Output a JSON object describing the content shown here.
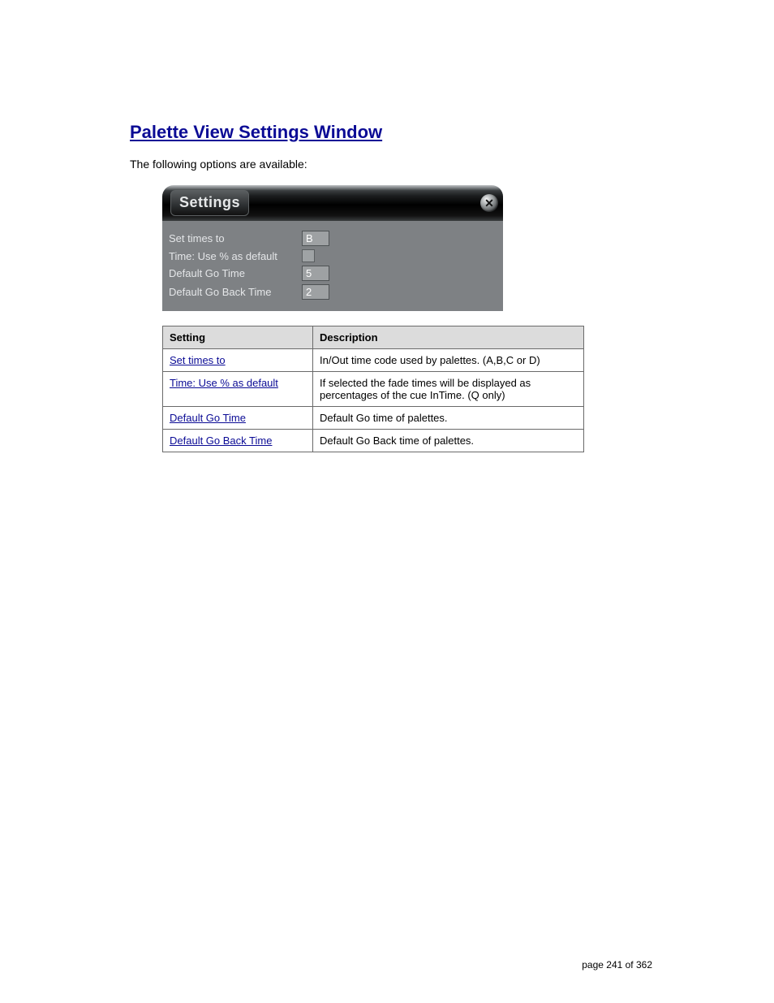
{
  "section": {
    "title_link": "Palette View Settings Window",
    "intro": "The following options are available:"
  },
  "screenshot": {
    "tab_label": "Settings",
    "close_glyph": "✕",
    "rows": [
      {
        "label": "Set times to",
        "type": "input",
        "value": "B"
      },
      {
        "label": "Time: Use % as default",
        "type": "checkbox"
      },
      {
        "label": "Default Go Time",
        "type": "input",
        "value": "5"
      },
      {
        "label": "Default Go Back Time",
        "type": "input",
        "value": "2"
      }
    ]
  },
  "table": {
    "headers": [
      "Setting",
      "Description"
    ],
    "rows": [
      {
        "setting": "Set times to",
        "description": "In/Out time code used by palettes. (A,B,C or D)"
      },
      {
        "setting": "Time: Use % as default",
        "description": "If selected the fade times will be displayed as percentages of the cue InTime. (Q only)"
      },
      {
        "setting": "Default Go Time",
        "description": "Default Go time of palettes."
      },
      {
        "setting": "Default Go Back Time",
        "description": "Default Go Back time of palettes."
      }
    ]
  },
  "footer": "page 241 of 362"
}
